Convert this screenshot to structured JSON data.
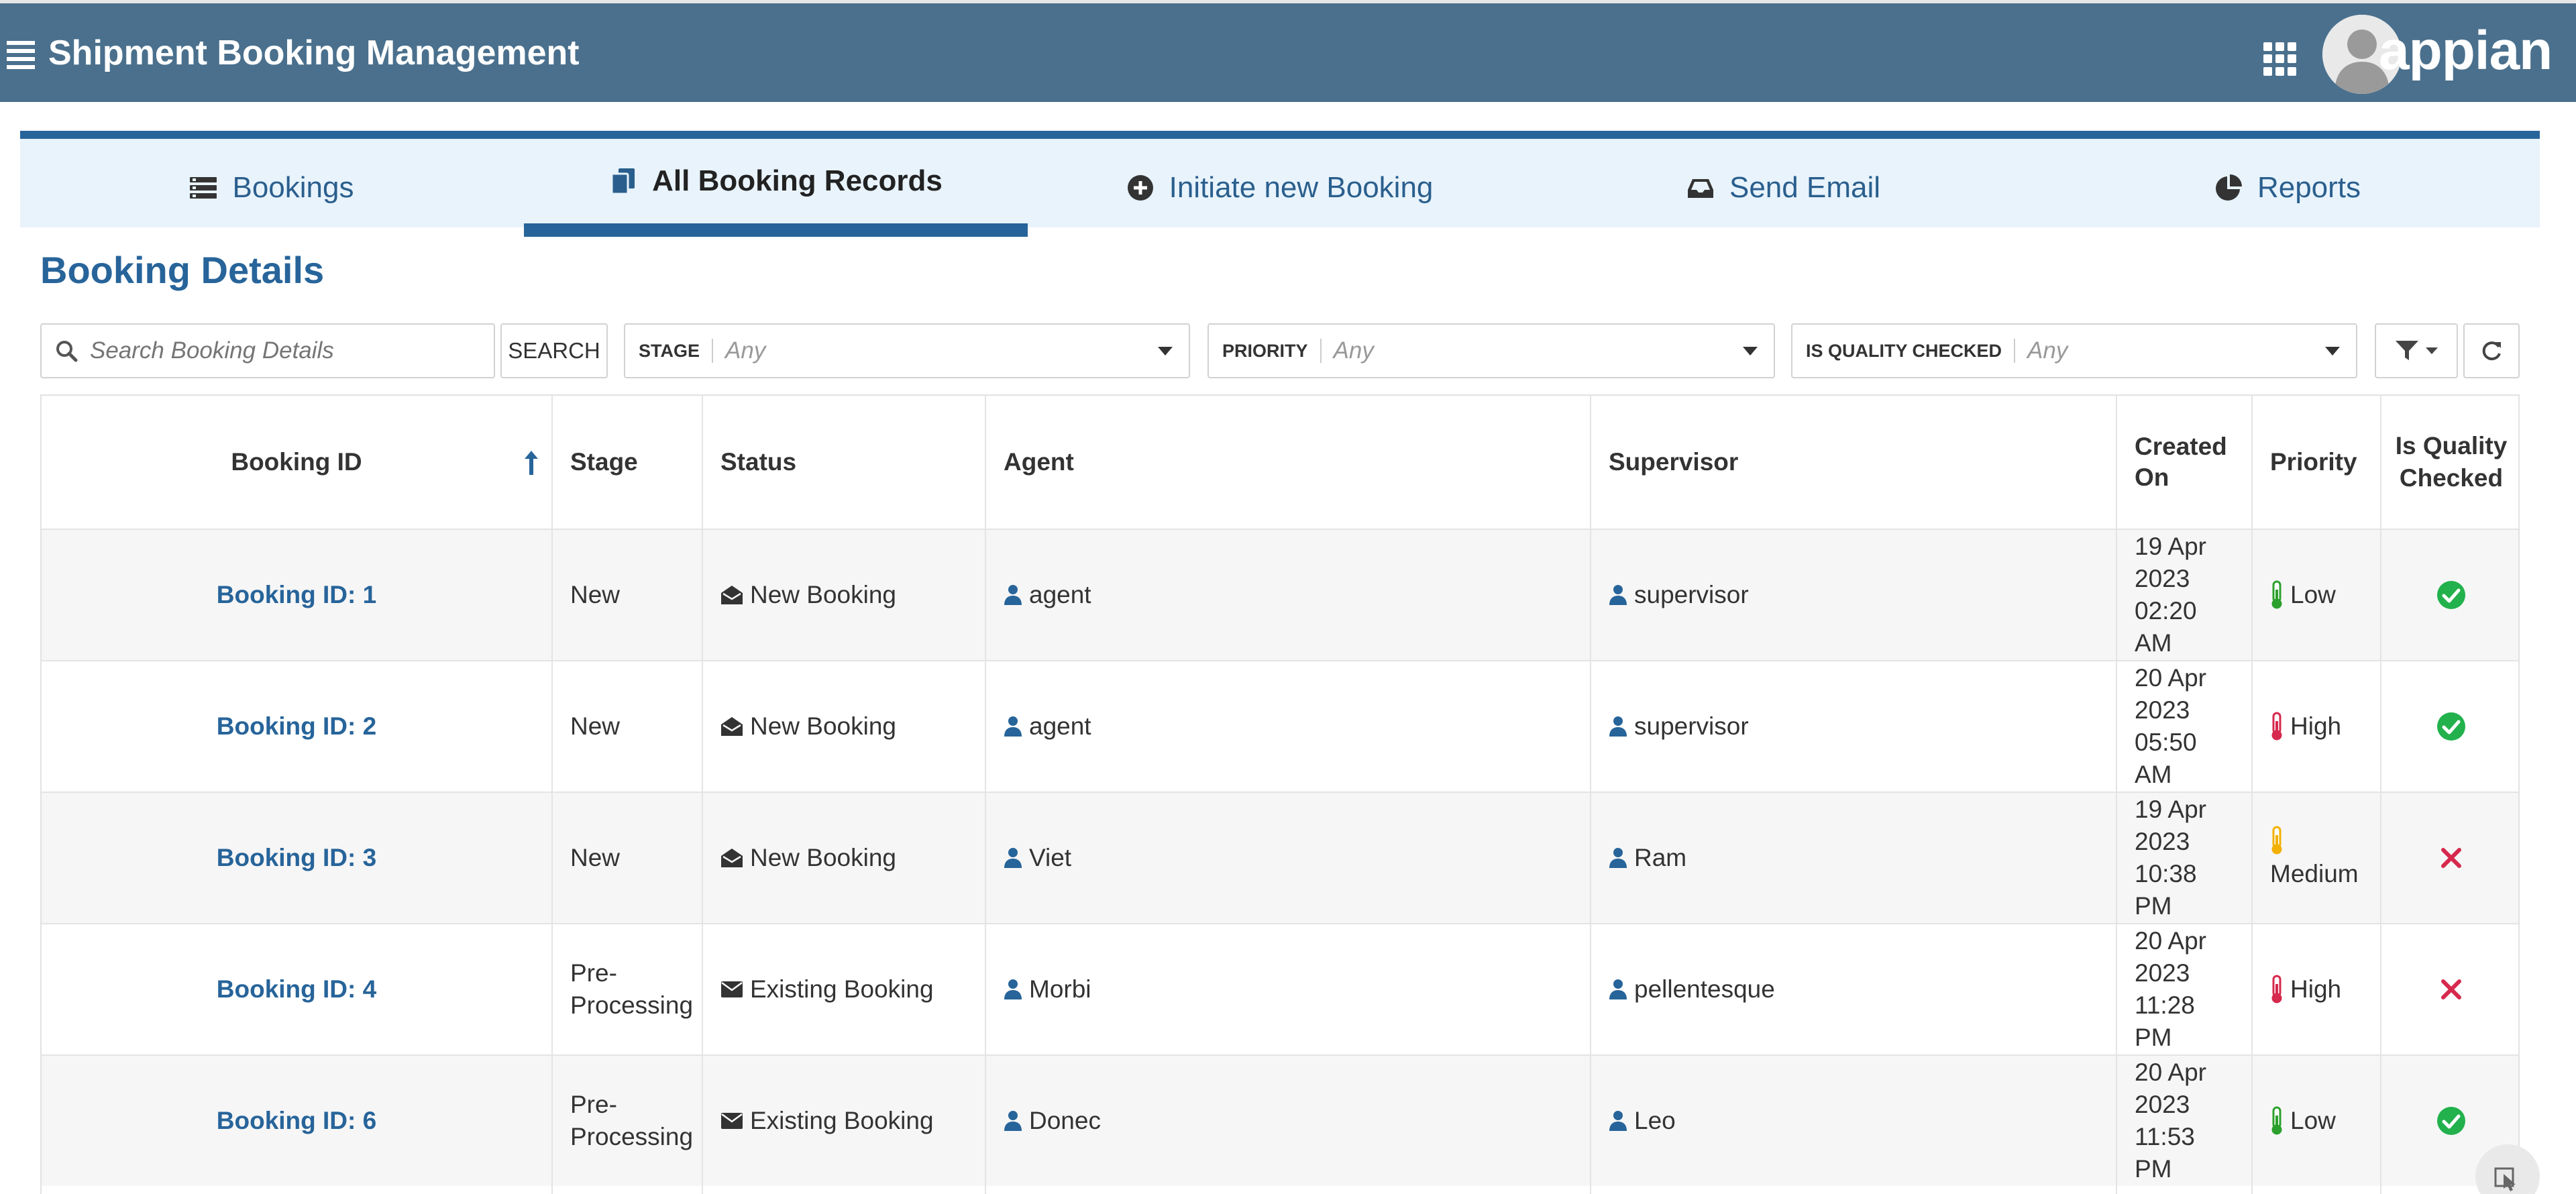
{
  "header": {
    "title": "Shipment Booking Management",
    "logo_text": "appian",
    "menu_icon": "hamburger-icon",
    "apps_icon": "grid-icon",
    "bg_color": "#4a708d"
  },
  "tabs": [
    {
      "label": "Bookings",
      "icon": "list-icon",
      "active": false
    },
    {
      "label": "All Booking Records",
      "icon": "documents-icon",
      "active": true
    },
    {
      "label": "Initiate new Booking",
      "icon": "plus-circle-icon",
      "active": false
    },
    {
      "label": "Send Email",
      "icon": "inbox-icon",
      "active": false
    },
    {
      "label": "Reports",
      "icon": "pie-chart-icon",
      "active": false
    }
  ],
  "section_title": "Booking Details",
  "filters": {
    "search_placeholder": "Search Booking Details",
    "search_button": "SEARCH",
    "stage": {
      "label": "STAGE",
      "value": "Any"
    },
    "priority": {
      "label": "PRIORITY",
      "value": "Any"
    },
    "quality": {
      "label": "IS QUALITY CHECKED",
      "value": "Any"
    }
  },
  "columns": {
    "booking_id": "Booking ID",
    "stage": "Stage",
    "status": "Status",
    "agent": "Agent",
    "supervisor": "Supervisor",
    "created_on": "Created On",
    "priority": "Priority",
    "quality": "Is Quality Checked"
  },
  "rows": [
    {
      "booking_id": "Booking ID: 1",
      "stage": "New",
      "status": "New Booking",
      "status_icon": "envelope-open-icon",
      "agent": "agent",
      "supervisor": "supervisor",
      "created_on": "19 Apr 2023 02:20 AM",
      "priority": "Low",
      "priority_color": "#2ca02c",
      "quality_checked": true
    },
    {
      "booking_id": "Booking ID: 2",
      "stage": "New",
      "status": "New Booking",
      "status_icon": "envelope-open-icon",
      "agent": "agent",
      "supervisor": "supervisor",
      "created_on": "20 Apr 2023 05:50 AM",
      "priority": "High",
      "priority_color": "#d6294d",
      "quality_checked": true
    },
    {
      "booking_id": "Booking ID: 3",
      "stage": "New",
      "status": "New Booking",
      "status_icon": "envelope-open-icon",
      "agent": "Viet",
      "supervisor": "Ram",
      "created_on": "19 Apr 2023 10:38 PM",
      "priority": "Medium",
      "priority_color": "#f2b000",
      "quality_checked": false
    },
    {
      "booking_id": "Booking ID: 4",
      "stage": "Pre-Processing",
      "status": "Existing Booking",
      "status_icon": "envelope-icon",
      "agent": "Morbi",
      "supervisor": "pellentesque",
      "created_on": "20 Apr 2023 11:28 PM",
      "priority": "High",
      "priority_color": "#d6294d",
      "quality_checked": false
    },
    {
      "booking_id": "Booking ID: 6",
      "stage": "Pre-Processing",
      "status": "Existing Booking",
      "status_icon": "envelope-icon",
      "agent": "Donec",
      "supervisor": "Leo",
      "created_on": "20 Apr 2023 11:53 PM",
      "priority": "Low",
      "priority_color": "#2ca02c",
      "quality_checked": true
    }
  ],
  "colors": {
    "accent": "#27649a",
    "check": "#22b14c",
    "cross": "#d6294d"
  }
}
